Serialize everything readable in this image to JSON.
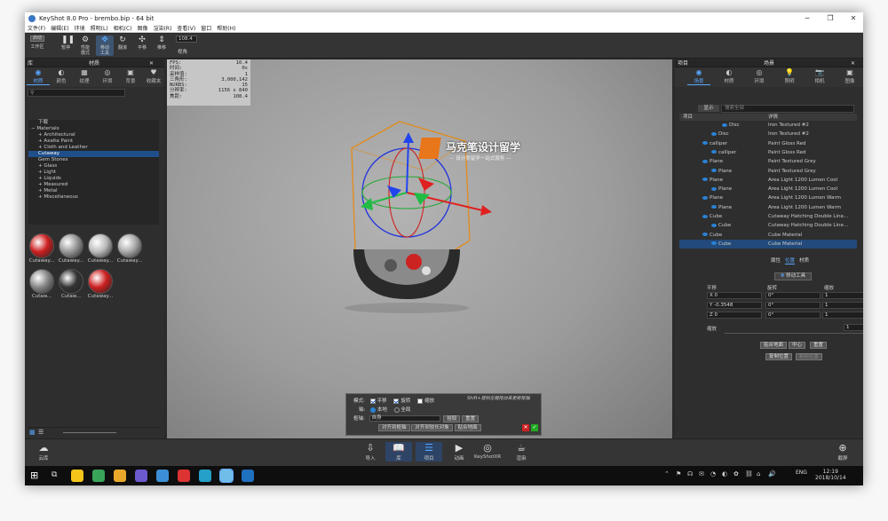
{
  "window": {
    "title": "KeyShot 8.0 Pro  - brembo.bip  - 64 bit"
  },
  "menu": [
    "文件(F)",
    "编辑(E)",
    "环境",
    "照明(L)",
    "相机(C)",
    "图像",
    "渲染(R)",
    "查看(V)",
    "窗口",
    "帮助(H)"
  ],
  "toolbar": {
    "cpu_badge": "启动",
    "items": [
      {
        "label": "工作区",
        "icon": "⌂"
      },
      {
        "label": "暂停",
        "icon": "❚❚"
      },
      {
        "label": "性能\n模式",
        "icon": "⚙"
      },
      {
        "label": "移动\n工具",
        "icon": "✥"
      },
      {
        "label": "翻滚",
        "icon": "↻"
      },
      {
        "label": "平移",
        "icon": "✣"
      },
      {
        "label": "推移",
        "icon": "⇕"
      }
    ],
    "zoom_value": "108.4",
    "zoom_label": "视角"
  },
  "library": {
    "panel_label": "库",
    "title": "材质",
    "tabs": [
      "材质",
      "颜色",
      "纹理",
      "环境",
      "背景",
      "收藏夹"
    ],
    "tree": [
      {
        "label": "下载",
        "indent": 1
      },
      {
        "label": "Materials",
        "indent": 0,
        "prefix": "−"
      },
      {
        "label": "Architectural",
        "indent": 1,
        "prefix": "+"
      },
      {
        "label": "Axalta Paint",
        "indent": 1,
        "prefix": "+"
      },
      {
        "label": "Cloth and Leather",
        "indent": 1,
        "prefix": "+"
      },
      {
        "label": "Cutaway",
        "indent": 1,
        "selected": true
      },
      {
        "label": "Gem Stones",
        "indent": 1
      },
      {
        "label": "Glass",
        "indent": 1,
        "prefix": "+"
      },
      {
        "label": "Light",
        "indent": 1,
        "prefix": "+"
      },
      {
        "label": "Liquids",
        "indent": 1,
        "prefix": "+"
      },
      {
        "label": "Measured",
        "indent": 1,
        "prefix": "+"
      },
      {
        "label": "Metal",
        "indent": 1,
        "prefix": "+"
      },
      {
        "label": "Miscellaneous",
        "indent": 1,
        "prefix": "+"
      }
    ],
    "thumbnails": [
      {
        "label": "Cutaway...",
        "color": "#cc2020"
      },
      {
        "label": "Cutaway...",
        "color": "#999999"
      },
      {
        "label": "Cutaway...",
        "color": "#bbbbbb"
      },
      {
        "label": "Cutaway...",
        "color": "#aaaaaa"
      },
      {
        "label": "Cutaw...",
        "color": "#888888"
      },
      {
        "label": "Cutaw...",
        "color": "#333333"
      },
      {
        "label": "Cutaway...",
        "color": "#cc2020"
      }
    ]
  },
  "viewport": {
    "stats": [
      [
        "FPS:",
        "10.4"
      ],
      [
        "时间:",
        "0s"
      ],
      [
        "采样值:",
        "1"
      ],
      [
        "三角形:",
        "3,000,142"
      ],
      [
        "NURBS:",
        "15"
      ],
      [
        "分辨率:",
        "1156 x 840"
      ],
      [
        "焦距:",
        "108.4"
      ]
    ],
    "watermark": {
      "title": "马克笔设计留学",
      "subtitle": "— 设计类留学一站式服务 —"
    },
    "dialog": {
      "mode_label": "模式:",
      "translate": "平移",
      "rotate": "旋转",
      "scale": "缩放",
      "hint": "Shift+鼠标左键拖动来更新枢轴",
      "axis_label": "轴:",
      "local": "本地",
      "global": "全局",
      "pivot_label": "枢轴:",
      "pivot_value": "自身",
      "pick": "拾取",
      "reset": "重置",
      "btn_align": "对齐到枢轴",
      "btn_align_obj": "对齐到较长对象",
      "btn_snap": "贴合地面"
    }
  },
  "scene": {
    "panel_label": "项目",
    "title": "场景",
    "tabs": [
      "场景",
      "材质",
      "环境",
      "照明",
      "相机",
      "图像"
    ],
    "show_label": "显示",
    "search_placeholder": "搜索全部",
    "col_item": "项目",
    "col_detail": "详情",
    "rows": [
      {
        "name": "Disc",
        "detail": "Iron Textured #2"
      },
      {
        "name": "Disc",
        "detail": "Iron Textured #2"
      },
      {
        "name": "calliper",
        "detail": "Paint Gloss Red"
      },
      {
        "name": "calliper",
        "detail": "Paint Gloss Red"
      },
      {
        "name": "Plane",
        "detail": "Paint Textured Grey"
      },
      {
        "name": "Plane",
        "detail": "Paint Textured Grey"
      },
      {
        "name": "Plane",
        "detail": "Area Light 1200 Lumen Cool"
      },
      {
        "name": "Plane",
        "detail": "Area Light 1200 Lumen Cool"
      },
      {
        "name": "Plane",
        "detail": "Area Light 1200 Lumen Warm"
      },
      {
        "name": "Plane",
        "detail": "Area Light 1200 Lumen Warm"
      },
      {
        "name": "Cube",
        "detail": "Cutaway Hatching Double Line..."
      },
      {
        "name": "Cube",
        "detail": "Cutaway Hatching Double Line..."
      },
      {
        "name": "Cube",
        "detail": "Cube Material"
      },
      {
        "name": "Cube",
        "detail": "Cube Material",
        "selected": true
      }
    ],
    "subtabs": [
      "属性",
      "位置",
      "材质"
    ],
    "move_tool": "移动工具",
    "transform": {
      "translate": "平移",
      "rotate": "旋转",
      "scale": "缩放",
      "rows": [
        [
          "X 0",
          "0°",
          "1"
        ],
        [
          "Y -0.3548",
          "0°",
          "1"
        ],
        [
          "Z 0",
          "0°",
          "1"
        ]
      ],
      "uniform": "缩放",
      "uniform_value": "1"
    },
    "buttons": [
      "贴合地面",
      "中心",
      "重置",
      "复制位置",
      "粘贴位置"
    ]
  },
  "dock": [
    {
      "label": "云库",
      "icon": "☁"
    },
    {
      "label": "导入",
      "icon": "⇩"
    },
    {
      "label": "库",
      "icon": "📖",
      "active": true
    },
    {
      "label": "项目",
      "icon": "☰",
      "active": true
    },
    {
      "label": "动画",
      "icon": "▶"
    },
    {
      "label": "KeyShotXR",
      "icon": "◎"
    },
    {
      "label": "渲染",
      "icon": "☕"
    },
    {
      "label": "截屏",
      "icon": "⊕"
    }
  ],
  "taskbar": {
    "time": "12:19",
    "date": "2018/10/14",
    "lang": "ENG",
    "apps": [
      "#f5c518",
      "#3aa35a",
      "#e8a82a",
      "#6a5acd",
      "#3c8fd6",
      "#d33",
      "#25a0c8",
      "#6fbde8",
      "#2070c0"
    ]
  }
}
